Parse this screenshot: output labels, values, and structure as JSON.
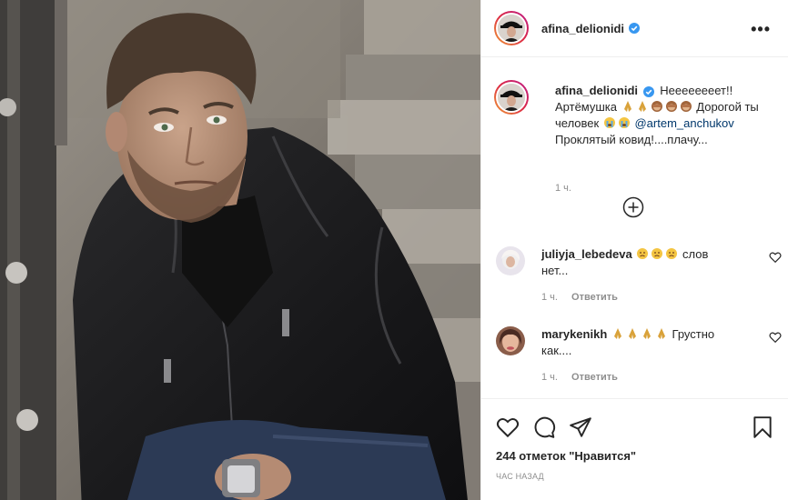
{
  "post": {
    "author": {
      "username": "afina_delionidi",
      "verified": true,
      "avatar": "woman-black-hat-avatar"
    },
    "more_options": "•••",
    "photo": {
      "description_icon": "man-leather-jacket-photo"
    },
    "caption": {
      "username": "afina_delionidi",
      "text_part1": "Неееееееет!! Артёмушка",
      "text_part2": "Дорогой ты человек",
      "mention": "@artem_anchukov",
      "text_part3": "Проклятый ковид!....плачу...",
      "time": "1 ч."
    },
    "load_more_icon": "plus-circle-icon",
    "comments": [
      {
        "username": "juliyja_lebedeva",
        "text": "слов нет...",
        "time": "1 ч.",
        "reply_label": "Ответить"
      },
      {
        "username": "marykenikh",
        "text": "Грустно как....",
        "time": "1 ч.",
        "reply_label": "Ответить"
      }
    ],
    "likes_text": "244 отметок \"Нравится\"",
    "posted_text": "ЧАС НАЗАД"
  },
  "colors": {
    "text": "#262626",
    "muted": "#8e8e8e",
    "verified": "#3897f0",
    "mention": "#00376b",
    "border": "#efefef"
  }
}
